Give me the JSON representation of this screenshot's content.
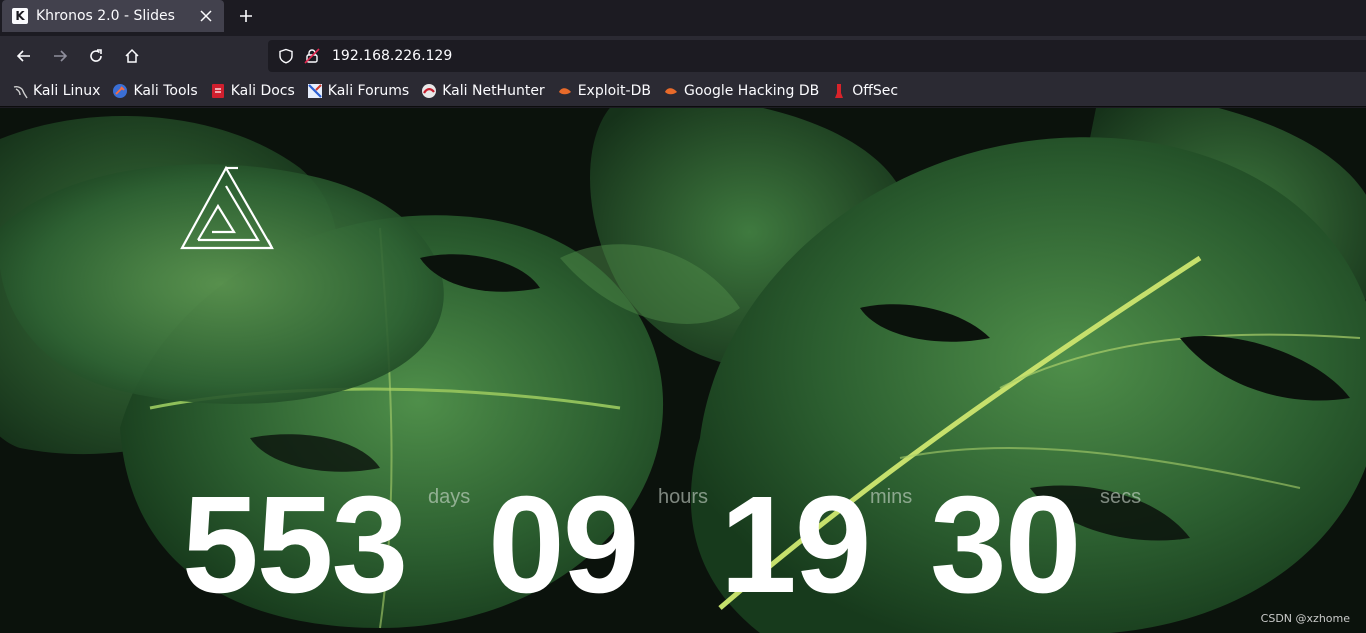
{
  "browser": {
    "tab": {
      "title": "Khronos 2.0 - Slides",
      "favicon_letter": "K"
    },
    "url": "192.168.226.129",
    "bookmarks": [
      {
        "label": "Kali Linux",
        "icon": "kali-dragon-icon"
      },
      {
        "label": "Kali Tools",
        "icon": "kali-tools-icon"
      },
      {
        "label": "Kali Docs",
        "icon": "kali-docs-icon"
      },
      {
        "label": "Kali Forums",
        "icon": "kali-forums-icon"
      },
      {
        "label": "Kali NetHunter",
        "icon": "nethunter-icon"
      },
      {
        "label": "Exploit-DB",
        "icon": "exploit-db-icon"
      },
      {
        "label": "Google Hacking DB",
        "icon": "ghdb-icon"
      },
      {
        "label": "OffSec",
        "icon": "offsec-icon"
      }
    ]
  },
  "countdown": {
    "days": {
      "value": "553",
      "unit": "days"
    },
    "hours": {
      "value": "09",
      "unit": "hours"
    },
    "mins": {
      "value": "19",
      "unit": "mins"
    },
    "secs": {
      "value": "30",
      "unit": "secs"
    }
  },
  "watermark": "CSDN @xzhome",
  "colors": {
    "chrome_dark": "#1c1b22",
    "chrome_mid": "#2b2a33",
    "tab_active": "#42414d",
    "leaf_green": "#2f6b36"
  }
}
